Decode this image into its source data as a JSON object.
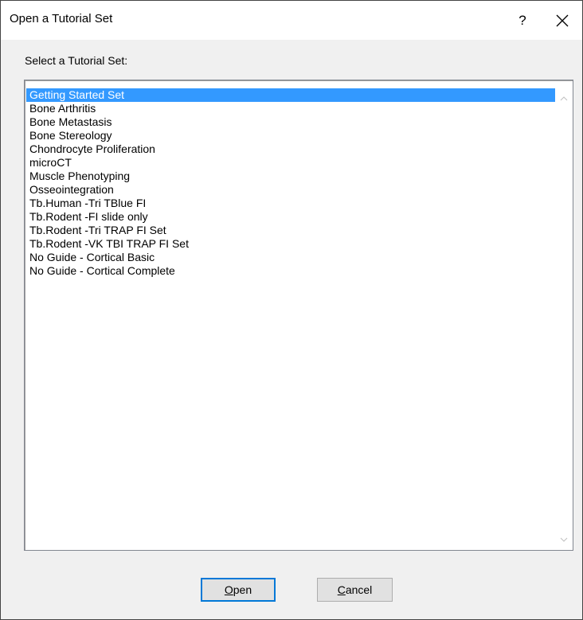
{
  "window": {
    "title": "Open a Tutorial Set",
    "help_label": "?",
    "close_icon": "close-icon"
  },
  "prompt": "Select a Tutorial Set:",
  "tutorial_sets": [
    "Getting Started Set",
    "Bone Arthritis",
    "Bone Metastasis",
    "Bone Stereology",
    "Chondrocyte Proliferation",
    "microCT",
    "Muscle Phenotyping",
    "Osseointegration",
    "Tb.Human -Tri TBlue FI",
    "Tb.Rodent -FI slide only",
    "Tb.Rodent -Tri TRAP FI Set",
    "Tb.Rodent -VK TBI TRAP FI Set",
    "No Guide - Cortical Basic",
    "No Guide - Cortical Complete"
  ],
  "selected_index": 0,
  "buttons": {
    "open": {
      "accel": "O",
      "rest": "pen"
    },
    "cancel": {
      "accel": "C",
      "rest": "ancel"
    }
  },
  "colors": {
    "selection": "#3399ff",
    "default_button_border": "#0078d7"
  }
}
